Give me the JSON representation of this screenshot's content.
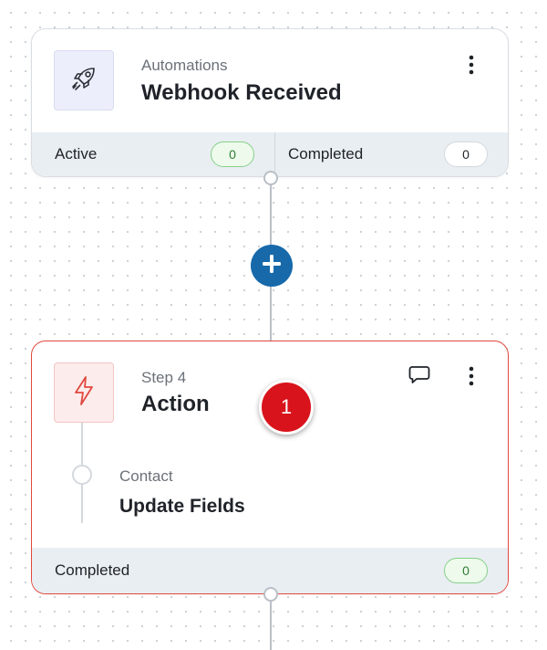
{
  "trigger": {
    "subtitle": "Automations",
    "title": "Webhook Received",
    "icon": "rocket-icon",
    "stats": {
      "active_label": "Active",
      "active_count": "0",
      "completed_label": "Completed",
      "completed_count": "0"
    }
  },
  "add_step": {
    "icon": "plus-icon"
  },
  "action": {
    "subtitle": "Step 4",
    "title": "Action",
    "icon": "lightning-icon",
    "detail": {
      "subtitle": "Contact",
      "title": "Update Fields"
    },
    "stats": {
      "completed_label": "Completed",
      "completed_count": "0"
    }
  },
  "marker": {
    "label": "1"
  },
  "colors": {
    "add_button": "#1769aa",
    "action_border": "#e0483e",
    "marker": "#d9131b",
    "active_pill": "#86d08a"
  }
}
